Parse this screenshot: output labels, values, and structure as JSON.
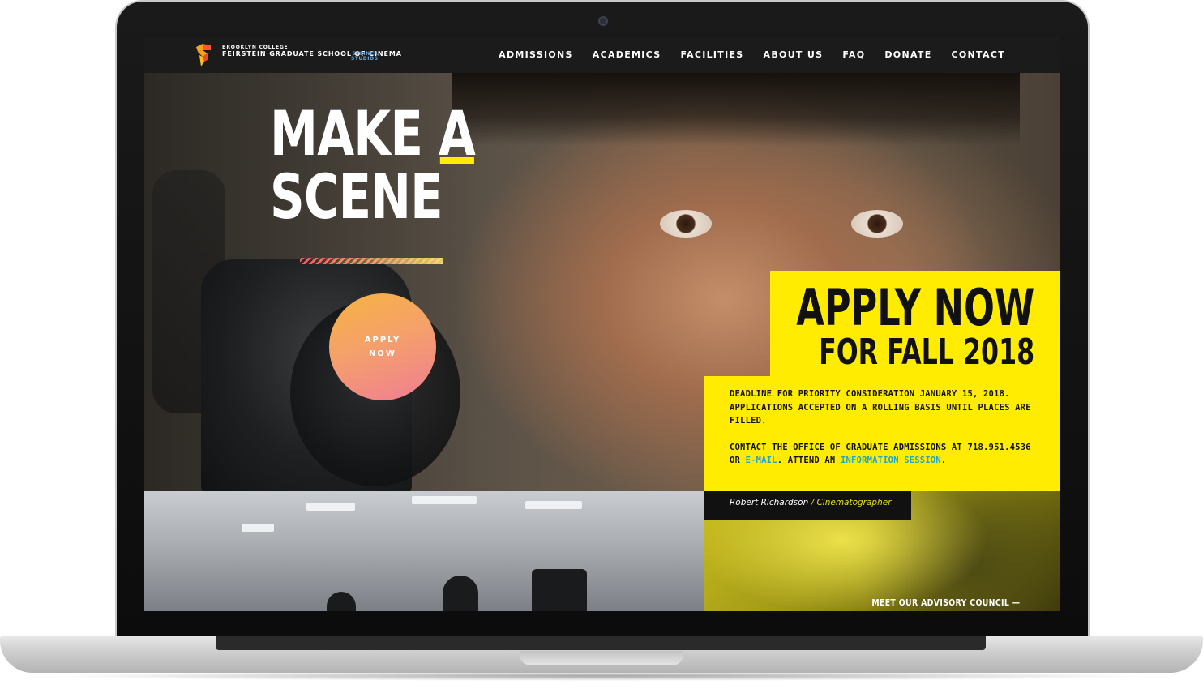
{
  "logo": {
    "small_text": "BROOKLYN COLLEGE",
    "main_text": "FEIRSTEIN GRADUATE SCHOOL OF CINEMA",
    "steiner_line1": "STEINER",
    "steiner_line2": "STUDIOS"
  },
  "nav": {
    "items": [
      "ADMISSIONS",
      "ACADEMICS",
      "FACILITIES",
      "ABOUT US",
      "FAQ",
      "DONATE",
      "CONTACT"
    ]
  },
  "hero": {
    "headline_line1_word1": "MAKE",
    "headline_line1_word2": "A",
    "headline_line2": "SCENE",
    "apply_button_line1": "APPLY",
    "apply_button_line2": "NOW"
  },
  "panel": {
    "title_line1": "APPLY NOW",
    "title_line2": "FOR FALL 2018",
    "paragraph1": "DEADLINE FOR PRIORITY CONSIDERATION JANUARY 15, 2018. APPLICATIONS ACCEPTED ON A ROLLING BASIS UNTIL PLACES ARE FILLED.",
    "paragraph2_prefix": "CONTACT THE OFFICE OF GRADUATE ADMISSIONS AT 718.951.4536 OR ",
    "email_link": "E-MAIL",
    "paragraph2_middle": ". ATTEND AN ",
    "info_session_link": "INFORMATION SESSION",
    "paragraph2_suffix": "."
  },
  "caption": {
    "name": "Robert Richardson",
    "separator": " / ",
    "role": "Cinematographer"
  },
  "council": {
    "link_label": "MEET OUR ADVISORY COUNCIL —"
  },
  "colors": {
    "accent_yellow": "#ffec00",
    "link_blue": "#1ea7cf",
    "nav_bg": "#1b1b1b",
    "apply_gradient_start": "#f7b341",
    "apply_gradient_end": "#f07d94"
  }
}
